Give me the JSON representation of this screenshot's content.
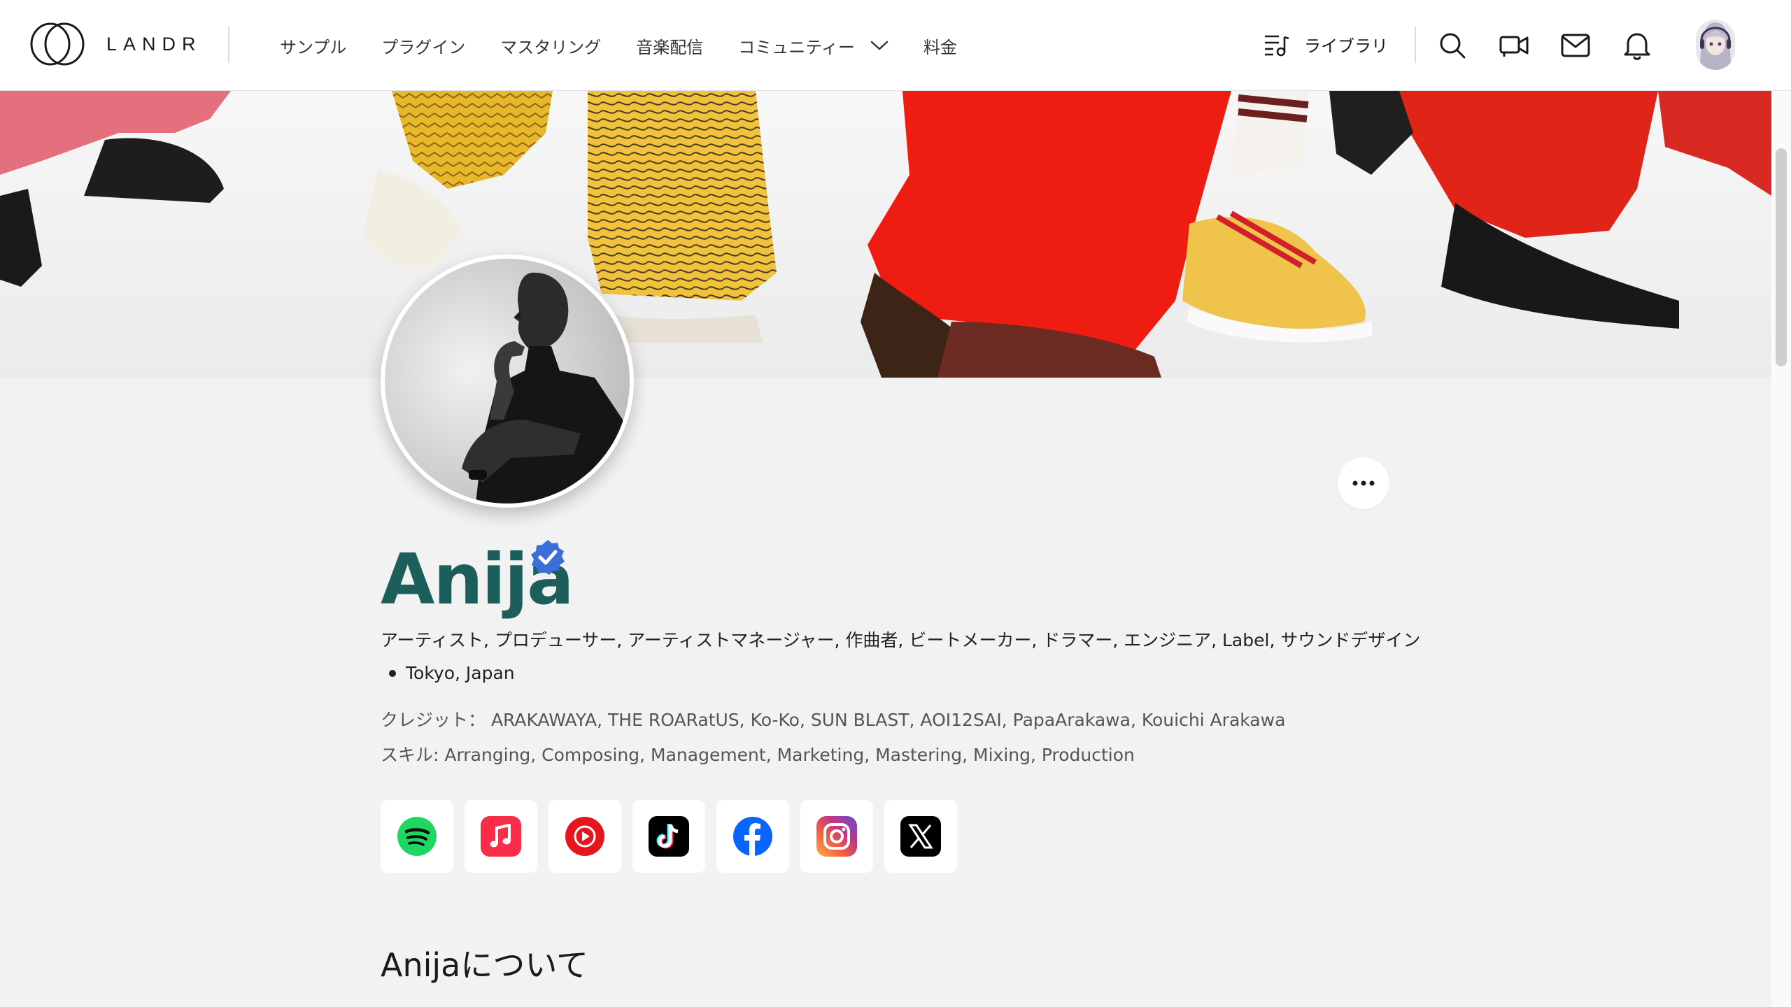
{
  "brand": {
    "name": "LANDR"
  },
  "nav": {
    "items": [
      {
        "label": "サンプル"
      },
      {
        "label": "プラグイン"
      },
      {
        "label": "マスタリング"
      },
      {
        "label": "音楽配信"
      },
      {
        "label": "コミュニティー"
      },
      {
        "label": "料金"
      }
    ]
  },
  "tools": {
    "library_label": "ライブラリ",
    "icons": [
      "library-icon",
      "search-icon",
      "video-icon",
      "mail-icon",
      "bell-icon",
      "user-avatar"
    ]
  },
  "profile": {
    "name": "Anija",
    "verified": true,
    "roles": "アーティスト, プロデューサー, アーティストマネージャー, 作曲者, ビートメーカー, ドラマー, エンジニア, Label, サウンドデザイン",
    "location": "Tokyo, Japan",
    "credits": "クレジット： ARAKAWAYA, THE ROARatUS, Ko-Ko, SUN BLAST, AOI12SAI, PapaArakawa, Kouichi Arakawa",
    "skills": "スキル: Arranging, Composing, Management, Marketing, Mastering, Mixing, Production",
    "socials": [
      "spotify",
      "apple-music",
      "youtube-music",
      "tiktok",
      "facebook",
      "instagram",
      "x"
    ],
    "about_heading": "Anijaについて"
  },
  "colors": {
    "name": "#1b5e5c",
    "verified": "#3b6fd8",
    "spotify": "#1ed760",
    "apple_music": "#fa2d48",
    "youtube_music": "#e8151e",
    "facebook": "#0866ff"
  }
}
